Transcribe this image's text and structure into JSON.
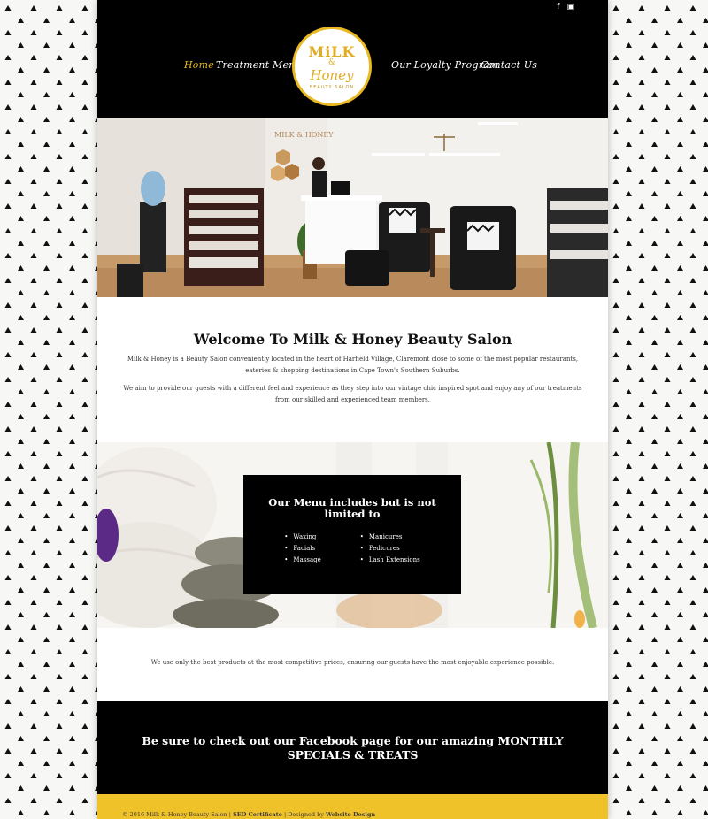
{
  "header": {
    "social": [
      "f",
      "▣"
    ],
    "nav": [
      "Home",
      "Treatment Menu",
      "Our Loyalty Program",
      "Contact Us"
    ],
    "logo": {
      "line1": "MiLK",
      "line2": "&",
      "line3": "Honey",
      "line4": "BEAUTY SALON"
    }
  },
  "hero": {
    "sign_text": "MILK & HONEY"
  },
  "welcome": {
    "title": "Welcome To Milk & Honey Beauty Salon",
    "para1": "Milk & Honey is a Beauty Salon conveniently located in the heart of Harfield Village, Claremont close to some of the most popular restaurants, eateries & shopping destinations in Cape Town's Southern Suburbs.",
    "para2": "We aim to provide our guests with a different feel and experience as they step into our vintage chic inspired spot and enjoy any of our treatments from our skilled and experienced team members."
  },
  "menu": {
    "title": "Our Menu includes but is not limited to",
    "left": [
      "Waxing",
      "Facials",
      "Massage"
    ],
    "right": [
      "Manicures",
      "Pedicures",
      "Lash Extensions"
    ]
  },
  "products": {
    "text": "We use only the best products at the most competitive prices, ensuring our guests have the most enjoyable experience possible."
  },
  "facebook": {
    "text": "Be sure to check out our Facebook page for our amazing MONTHLY SPECIALS & TREATS"
  },
  "footer": {
    "copyright": "© 2016 Milk & Honey Beauty Salon | ",
    "seo": "SEO Certificate",
    "sep": " | Designed by ",
    "designer": "Website Design"
  },
  "colors": {
    "accent": "#e8b923",
    "black": "#000000",
    "footer": "#f0c229"
  }
}
